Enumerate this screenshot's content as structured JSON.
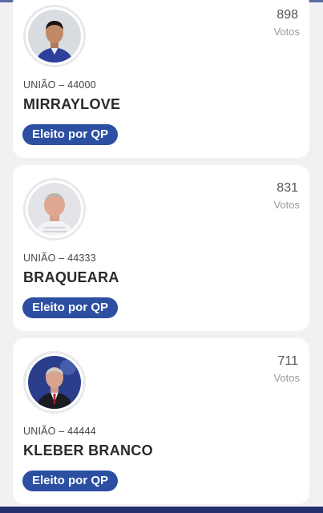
{
  "candidates": [
    {
      "votes": "898",
      "votes_label": "Votos",
      "party_number": "UNIÃO – 44000",
      "name": "MIRRAYLOVE",
      "status": "Eleito por QP"
    },
    {
      "votes": "831",
      "votes_label": "Votos",
      "party_number": "UNIÃO – 44333",
      "name": "BRAQUEARA",
      "status": "Eleito por QP"
    },
    {
      "votes": "711",
      "votes_label": "Votos",
      "party_number": "UNIÃO – 44444",
      "name": "KLEBER BRANCO",
      "status": "Eleito por QP"
    }
  ],
  "colors": {
    "badge": "#2c4fa2",
    "background": "#f1f1f3",
    "bottom_bar": "#262f6f"
  }
}
